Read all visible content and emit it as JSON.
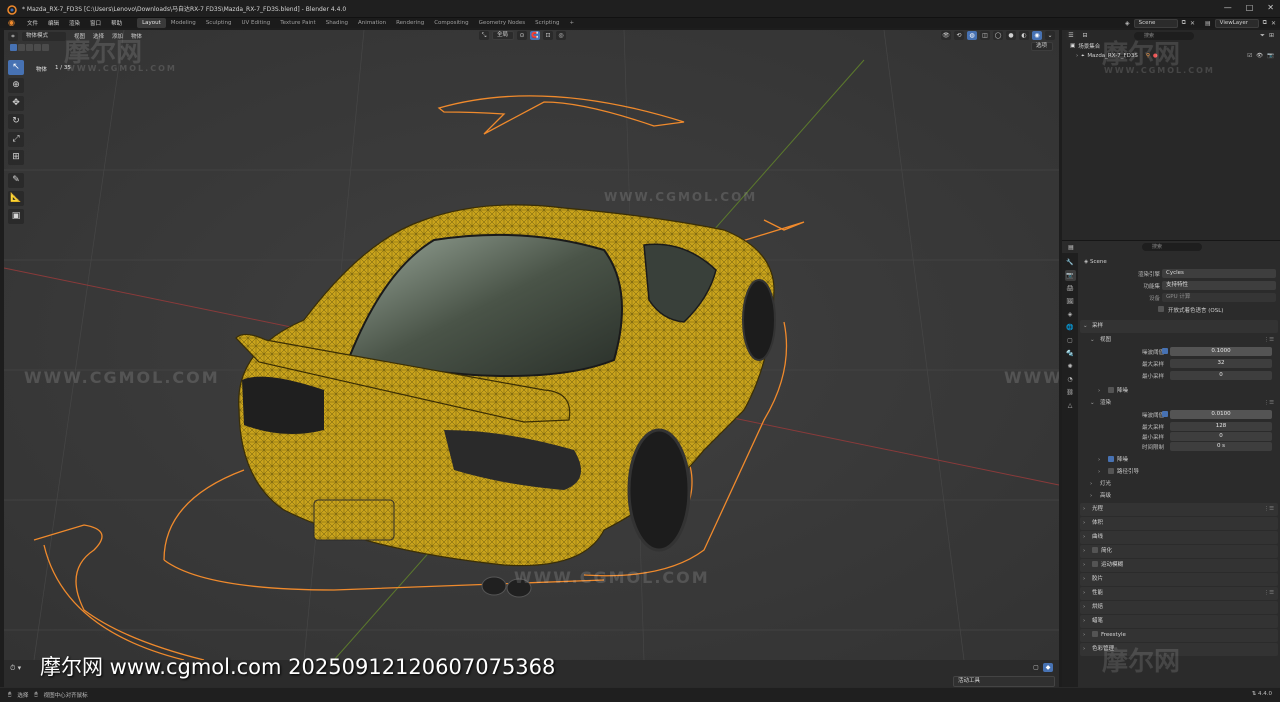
{
  "window": {
    "title": "* Mazda_RX-7_FD3S [C:\\Users\\Lenovo\\Downloads\\马自达RX-7 FD3S\\Mazda_RX-7_FD3S.blend] - Blender 4.4.0",
    "controls": [
      "—",
      "□",
      "✕"
    ]
  },
  "menu": {
    "items": [
      "文件",
      "编辑",
      "渲染",
      "窗口",
      "帮助"
    ],
    "workspaces": [
      "Layout",
      "Modeling",
      "Sculpting",
      "UV Editing",
      "Texture Paint",
      "Shading",
      "Animation",
      "Rendering",
      "Compositing",
      "Geometry Nodes",
      "Scripting"
    ],
    "add_tab": "+",
    "scene": "Scene",
    "view_layer": "ViewLayer"
  },
  "viewport": {
    "mode": "物体模式",
    "menus": [
      "视图",
      "选择",
      "添加",
      "物体"
    ],
    "transform": "全局",
    "select_label": "选项",
    "stats_label": "物体",
    "stats_value": "1 / 35",
    "sub_label": ""
  },
  "toolbar": {
    "tools": [
      {
        "name": "select-tool",
        "glyph": "↖"
      },
      {
        "name": "cursor-tool",
        "glyph": "⊕"
      },
      {
        "name": "move-tool",
        "glyph": "✥"
      },
      {
        "name": "rotate-tool",
        "glyph": "↻"
      },
      {
        "name": "scale-tool",
        "glyph": "⤢"
      },
      {
        "name": "transform-tool",
        "glyph": "⊞"
      },
      {
        "name": "annotate-tool",
        "glyph": "✎"
      },
      {
        "name": "measure-tool",
        "glyph": "📐"
      },
      {
        "name": "add-cube-tool",
        "glyph": "▣"
      }
    ]
  },
  "watermark": {
    "site": "WWW.CGMOL.COM",
    "logo": "摩尔网"
  },
  "caption": "摩尔网 www.cgmol.com 20250912120607075368",
  "timeline": {
    "active_tool": "活动工具"
  },
  "status": {
    "left_items": [
      "选择",
      "视图中心对齐鼠标"
    ],
    "version": "4.4.0"
  },
  "outliner": {
    "search_placeholder": "搜索",
    "collection": "场景集合",
    "object": "Mazda_RX-7_FD3S"
  },
  "properties": {
    "search_placeholder": "搜索",
    "scene_name": "Scene",
    "render_engine_label": "渲染引擎",
    "render_engine": "Cycles",
    "feature_set_label": "功能集",
    "feature_set": "支持特性",
    "device_label": "设备",
    "device": "GPU 计算",
    "osl_label": "开放式着色语言 (OSL)",
    "sampling": "采样",
    "viewport_section": "视图",
    "noise_threshold_label": "噪波阈值",
    "vp_noise": "0.1000",
    "max_samples_label": "最大采样",
    "vp_max": "32",
    "min_samples_label": "最小采样",
    "vp_min": "0",
    "denoise": "降噪",
    "render_section": "渲染",
    "r_noise": "0.0100",
    "r_max": "128",
    "r_min": "0",
    "time_limit_label": "时间限制",
    "r_time": "0 s",
    "render_denoise": "降噪",
    "path_guiding": "路径引导",
    "lights": "灯光",
    "advanced": "高级",
    "panels": [
      "光程",
      "体积",
      "曲线",
      "简化",
      "运动模糊",
      "胶片",
      "性能",
      "烘焙",
      "蜡笔",
      "Freestyle",
      "色彩管理"
    ]
  },
  "colors": {
    "viewport_bg": "#3a3a3a",
    "car_body": "#c9a31c",
    "selection_outline": "#f08a2c",
    "accent": "#4772b3"
  }
}
